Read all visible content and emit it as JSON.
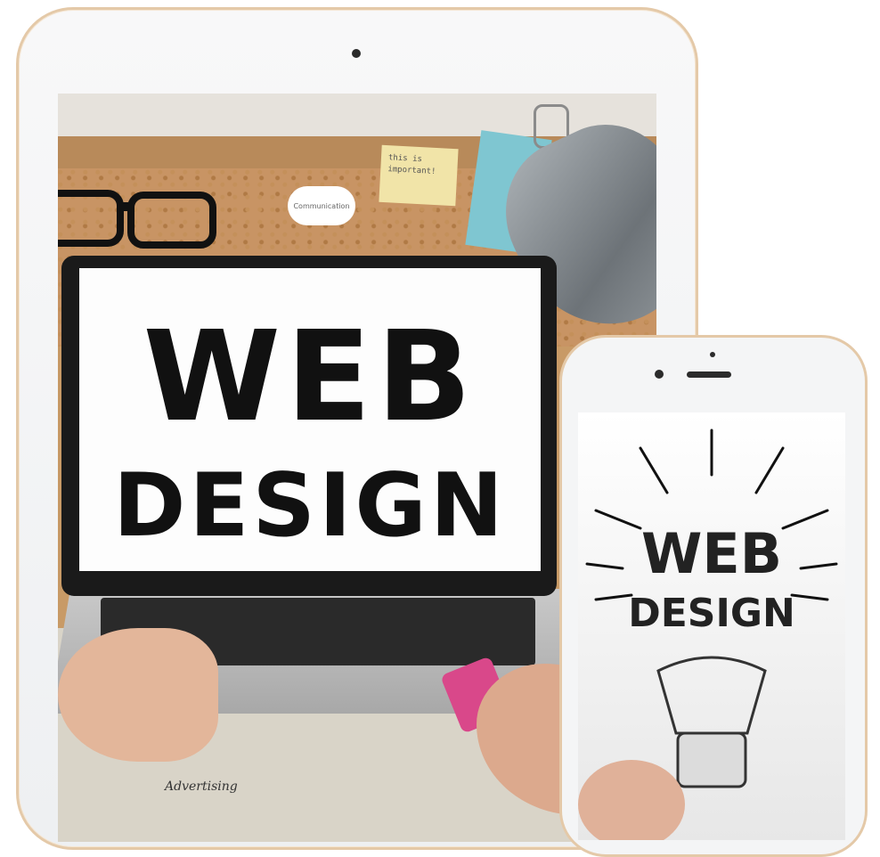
{
  "tablet": {
    "screen_image": "web-design-laptop-photo",
    "laptop_text_line1": "WEB",
    "laptop_text_line2": "DESIGN",
    "sticky_note": "this is important!",
    "speech_bubble": "Communication",
    "paper_note": "Advertising"
  },
  "phone": {
    "screen_image": "web-design-lightbulb-sketch",
    "bulb_text_line1": "WEB",
    "bulb_text_line2": "DESIGN"
  },
  "colors": {
    "device_frame": "#e4c9a8",
    "device_body": "#f4f5f6"
  }
}
